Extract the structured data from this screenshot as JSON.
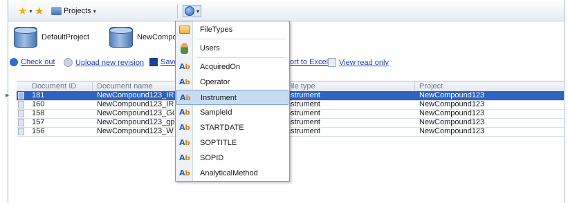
{
  "toolbar": {
    "projects_label": "Projects",
    "projects_arrow": "▾",
    "config_arrow": "▾"
  },
  "projects": [
    {
      "name": "DefaultProject"
    },
    {
      "name": "NewCompou"
    }
  ],
  "actions": {
    "check_out": "Check out",
    "upload": "Upload new revision",
    "save": "Save",
    "export": "ort to Excel",
    "view_read_only": "View read only"
  },
  "grid": {
    "columns": [
      "Document ID",
      "Document name",
      "File type",
      "Project"
    ],
    "rows": [
      {
        "id": "181",
        "name": "NewCompound123_IR2",
        "file_type": "nstrument",
        "project": "NewCompound123",
        "selected": true
      },
      {
        "id": "160",
        "name": "NewCompound123_IR.p",
        "file_type": "nstrument",
        "project": "NewCompound123",
        "selected": false
      },
      {
        "id": "158",
        "name": "NewCompound123_GCM",
        "file_type": "nstrument",
        "project": "NewCompound123",
        "selected": false
      },
      {
        "id": "157",
        "name": "NewCompound123_gps.",
        "file_type": "nstrument",
        "project": "NewCompound123",
        "selected": false
      },
      {
        "id": "156",
        "name": "NewCompound123_W",
        "file_type": "nstrument",
        "project": "NewCompound123",
        "selected": false
      }
    ]
  },
  "menu": {
    "items": [
      {
        "label": "FileTypes",
        "icon": "folder-icon"
      },
      {
        "label": "Users",
        "icon": "users-icon"
      },
      {
        "label": "AcquiredOn",
        "icon": "attribute-icon"
      },
      {
        "label": "Operator",
        "icon": "attribute-icon"
      },
      {
        "label": "Instrument",
        "icon": "attribute-icon",
        "highlighted": true
      },
      {
        "label": "SampleId",
        "icon": "attribute-icon"
      },
      {
        "label": "STARTDATE",
        "icon": "attribute-icon"
      },
      {
        "label": "SOPTITLE",
        "icon": "attribute-icon"
      },
      {
        "label": "SOPID",
        "icon": "attribute-icon"
      },
      {
        "label": "AnalyticalMethod",
        "icon": "attribute-icon"
      }
    ],
    "attribute_glyph": "A",
    "attribute_glyph_sub": "b"
  },
  "colors": {
    "selection": "#2e63c2",
    "link": "#1f3fb0",
    "menu_highlight": "#c8dcf4"
  }
}
